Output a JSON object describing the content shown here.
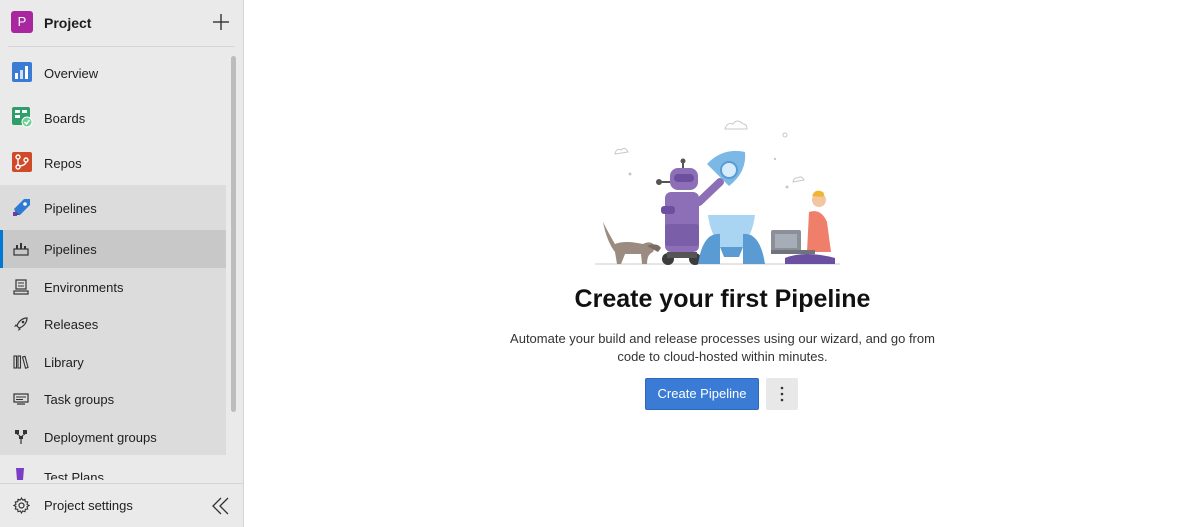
{
  "project": {
    "initial": "P",
    "name": "Project"
  },
  "nav": {
    "overview": "Overview",
    "boards": "Boards",
    "repos": "Repos",
    "pipelines": "Pipelines"
  },
  "subnav": {
    "pipelines": "Pipelines",
    "environments": "Environments",
    "releases": "Releases",
    "library": "Library",
    "task_groups": "Task groups",
    "deployment_groups": "Deployment groups"
  },
  "cutoff": {
    "test_plans": "Test Plans"
  },
  "footer": {
    "settings": "Project settings"
  },
  "main": {
    "title": "Create your first Pipeline",
    "description": "Automate your build and release processes using our wizard, and go from code to cloud-hosted within minutes.",
    "create_button": "Create Pipeline",
    "more_button": "⋮"
  },
  "colors": {
    "accent": "#3a7bd5",
    "project_avatar": "#a8279e",
    "sidebar_bg": "#eaeaea"
  }
}
